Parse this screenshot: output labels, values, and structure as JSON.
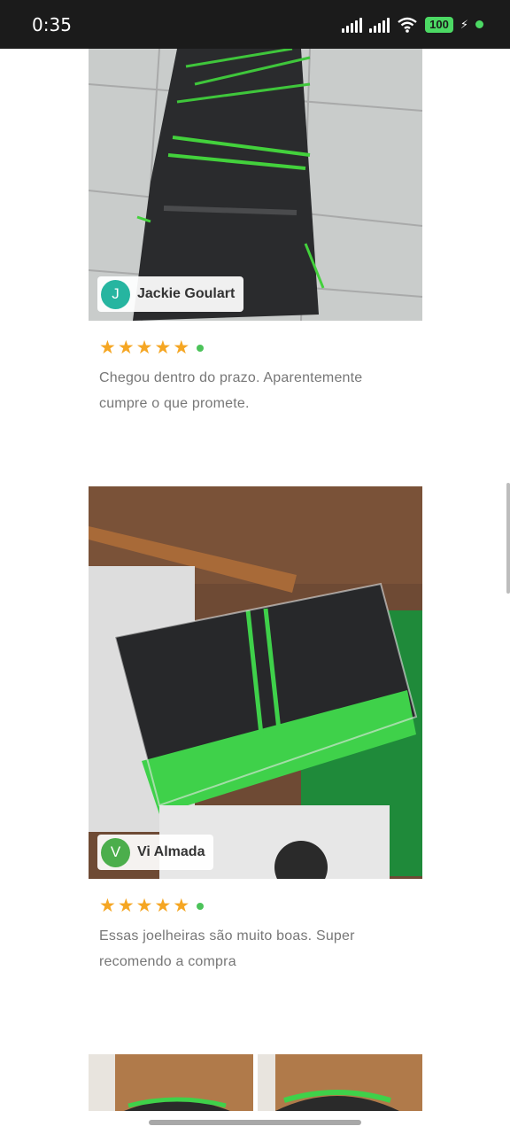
{
  "status_bar": {
    "time": "0:35",
    "battery": "100",
    "charging_symbol": "⚡"
  },
  "reviews": [
    {
      "author_initial": "J",
      "author_name": "Jackie Goulart",
      "avatar_color": "#26b5a0",
      "rating": 5,
      "text": "Chegou dentro do prazo. Aparentemente cumpre o que promete."
    },
    {
      "author_initial": "V",
      "author_name": "Vi Almada",
      "avatar_color": "#4cae4c",
      "rating": 5,
      "text": "Essas joelheiras são muito boas. Super recomendo a compra"
    }
  ],
  "colors": {
    "star": "#f5a623",
    "verified": "#4cc35a",
    "status_bar_bg": "#1b1b1b"
  }
}
